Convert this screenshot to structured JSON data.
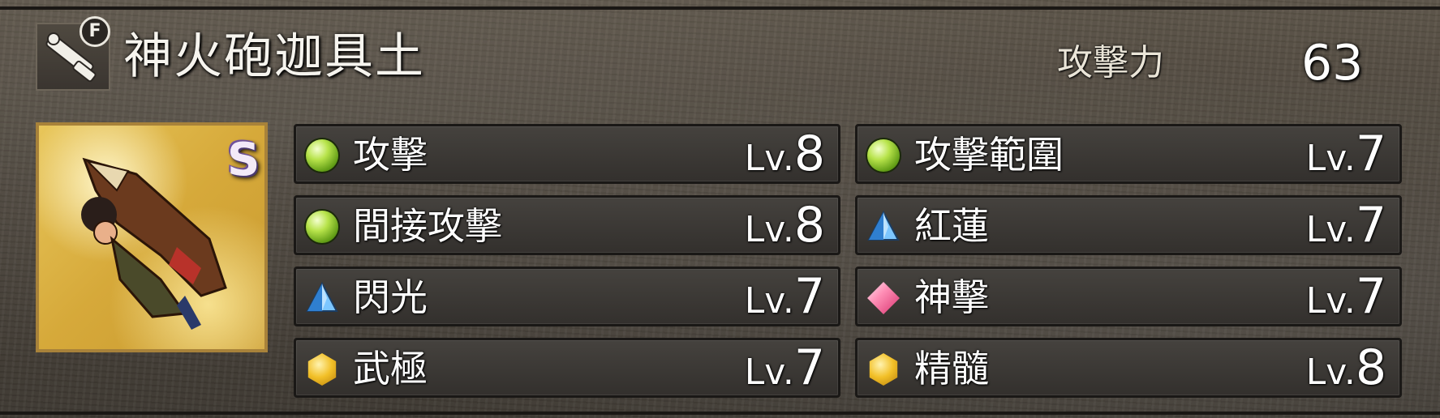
{
  "header": {
    "weapon_name": "神火砲迦具土",
    "f_badge": "F",
    "attack_label": "攻擊力",
    "attack_value": "63"
  },
  "portrait": {
    "rank": "S",
    "icon": "cannon-warrior-portrait"
  },
  "weapon_icon": "cannon-icon",
  "skills": [
    {
      "name": "攻擊",
      "lv_prefix": "Lv.",
      "level": "8",
      "gem": "green-orb-icon"
    },
    {
      "name": "攻擊範圍",
      "lv_prefix": "Lv.",
      "level": "7",
      "gem": "green-orb-icon"
    },
    {
      "name": "間接攻擊",
      "lv_prefix": "Lv.",
      "level": "8",
      "gem": "green-orb-icon"
    },
    {
      "name": "紅蓮",
      "lv_prefix": "Lv.",
      "level": "7",
      "gem": "blue-pyramid-icon"
    },
    {
      "name": "閃光",
      "lv_prefix": "Lv.",
      "level": "7",
      "gem": "blue-pyramid-icon"
    },
    {
      "name": "神擊",
      "lv_prefix": "Lv.",
      "level": "7",
      "gem": "pink-diamond-icon"
    },
    {
      "name": "武極",
      "lv_prefix": "Lv.",
      "level": "7",
      "gem": "gold-hexagon-icon"
    },
    {
      "name": "精髓",
      "lv_prefix": "Lv.",
      "level": "8",
      "gem": "gold-hexagon-icon"
    }
  ],
  "colors": {
    "text": "#ffffff",
    "slot_bg": "#3a3733",
    "frame_gold": "#a8823a",
    "green_gem": "#8ccf2e",
    "blue_gem": "#4aa8f0",
    "gold_gem": "#f2c028",
    "pink_gem": "#ff6f9e"
  }
}
